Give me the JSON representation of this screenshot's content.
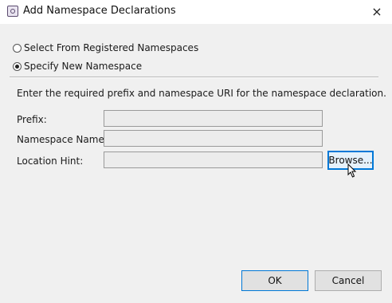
{
  "window": {
    "title": "Add Namespace Declarations",
    "close_icon": "×"
  },
  "options": {
    "registered_label": "Select From Registered Namespaces",
    "new_label": "Specify New Namespace",
    "selected": "new"
  },
  "description": "Enter the required prefix and namespace URI for the namespace declaration.",
  "fields": {
    "prefix_label": "Prefix:",
    "prefix_value": "",
    "namespace_label": "Namespace Name:",
    "namespace_value": "",
    "location_label": "Location Hint:",
    "location_value": ""
  },
  "buttons": {
    "browse": "Browse...",
    "ok": "OK",
    "cancel": "Cancel"
  },
  "colors": {
    "accent": "#0078d7"
  }
}
